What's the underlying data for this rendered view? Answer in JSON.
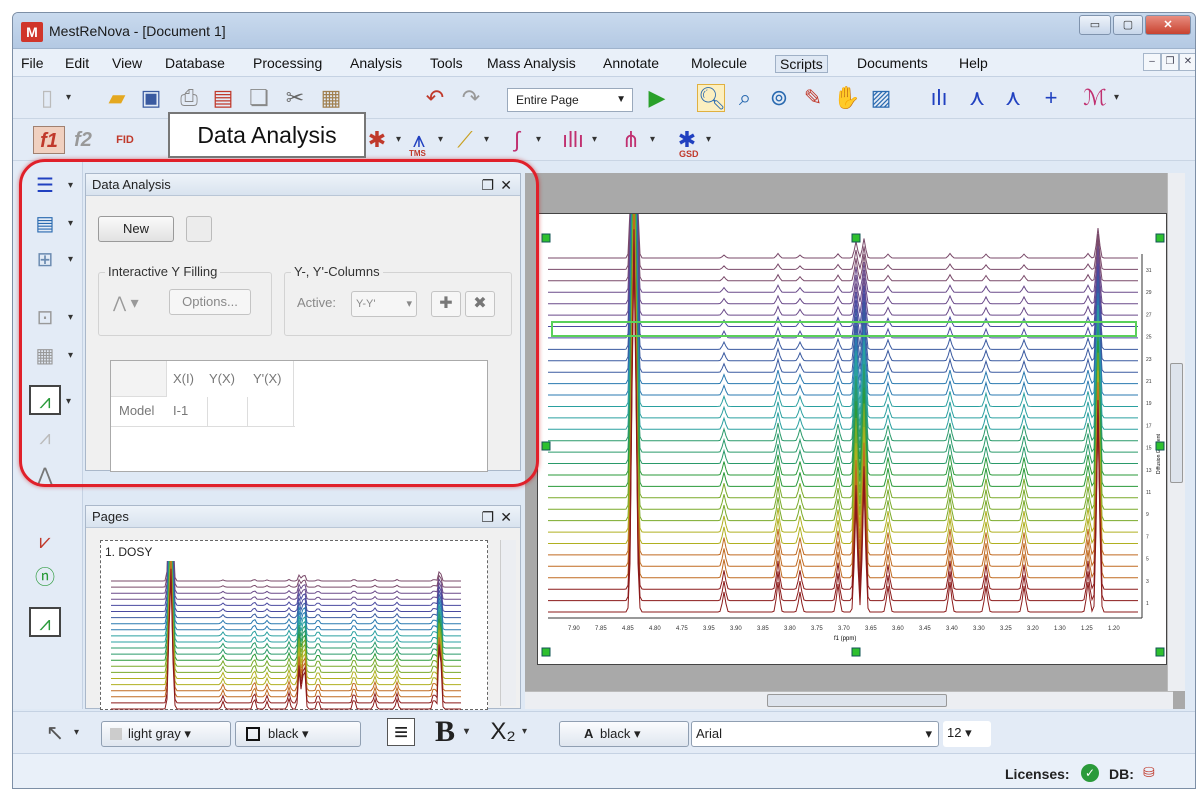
{
  "window": {
    "title": "MestReNova - [Document 1]",
    "app_icon": "M"
  },
  "menu": [
    "File",
    "Edit",
    "View",
    "Database",
    "Processing",
    "Analysis",
    "Tools",
    "Mass Analysis",
    "Annotate",
    "Molecule",
    "Scripts",
    "Documents",
    "Help"
  ],
  "toolbar": {
    "page_select": "Entire Page",
    "fid_label": "FID",
    "f1": "f1",
    "f2": "f2",
    "tms_label": "TMS",
    "gsd_label": "GSD"
  },
  "callout": "Data Analysis",
  "data_analysis_panel": {
    "title": "Data Analysis",
    "new_button": "New",
    "interactive_group": "Interactive Y Filling",
    "options_button": "Options...",
    "columns_group": "Y-, Y'-Columns",
    "active_label": "Active:",
    "active_value": "Y-Y'",
    "table": {
      "headers": [
        "X(I)",
        "Y(X)",
        "Y'(X)"
      ],
      "row_label": "Model",
      "cells": [
        "I-1",
        "",
        ""
      ]
    }
  },
  "pages_panel": {
    "title": "Pages",
    "page_label": "1. DOSY"
  },
  "spectrum": {
    "x_ticks": [
      "7.90",
      "7.85",
      "4.85",
      "4.80",
      "4.75",
      "3.95",
      "3.90",
      "3.85",
      "3.80",
      "3.75",
      "3.70",
      "3.65",
      "3.60",
      "3.45",
      "3.40",
      "3.30",
      "3.25",
      "3.20",
      "1.30",
      "1.25",
      "1.20"
    ],
    "x_label": "f1 (ppm)",
    "y_ticks": [
      "31",
      "29",
      "27",
      "25",
      "23",
      "21",
      "19",
      "17",
      "15",
      "13",
      "11",
      "9",
      "7",
      "5",
      "3",
      "1"
    ],
    "y_label": "Diffusion Gradient",
    "colors": {
      "top": "#7a4a6a",
      "mid": "#3a5aa0",
      "teal": "#2aa0a0",
      "green": "#2a9a3a",
      "yellow": "#b0b020",
      "bottom": "#8b1a1a"
    }
  },
  "format_bar": {
    "fill_color": "light gray",
    "line_color": "black",
    "font_color": "black",
    "font": "Arial",
    "size": "12"
  },
  "status": {
    "licenses": "Licenses:",
    "db": "DB:"
  },
  "accent": "#e0202a"
}
